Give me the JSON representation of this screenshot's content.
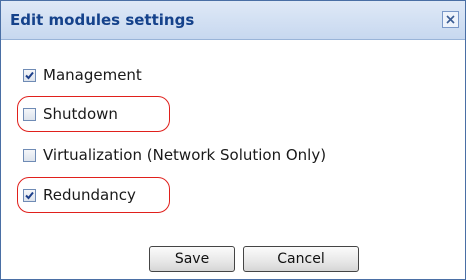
{
  "dialog": {
    "title": "Edit modules settings",
    "close_icon": "close-icon"
  },
  "options": [
    {
      "label": "Management",
      "checked": true,
      "highlighted": false
    },
    {
      "label": "Shutdown",
      "checked": false,
      "highlighted": true
    },
    {
      "label": "Virtualization (Network Solution Only)",
      "checked": false,
      "highlighted": false
    },
    {
      "label": "Redundancy",
      "checked": true,
      "highlighted": true
    }
  ],
  "buttons": {
    "save_label": "Save",
    "cancel_label": "Cancel"
  },
  "colors": {
    "title_text": "#15428b",
    "highlight_ring": "#e0201c",
    "check_mark": "#1d3f8a"
  }
}
